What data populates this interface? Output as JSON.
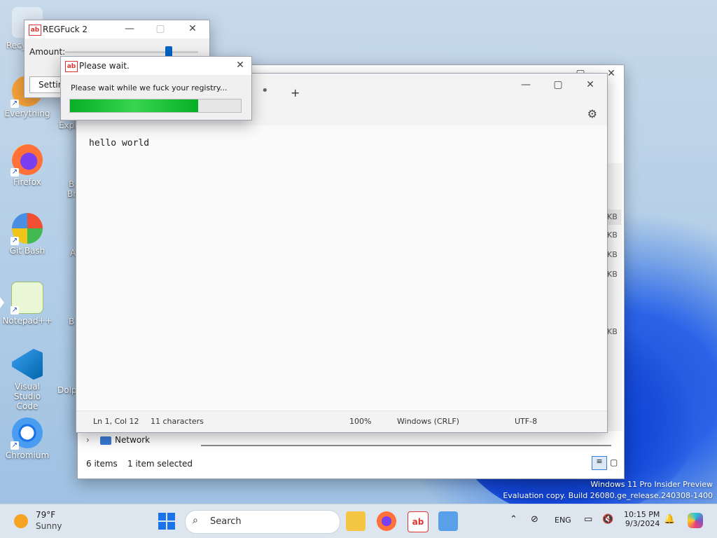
{
  "desktop": {
    "icons": [
      {
        "label": "Recy",
        "icon": "recycle-bin-icon"
      },
      {
        "label": "Everything",
        "icon": "everything-icon"
      },
      {
        "label": "Firefox",
        "icon": "firefox-icon"
      },
      {
        "label": "Git Bash",
        "icon": "git-bash-icon"
      },
      {
        "label": "Notepad++",
        "icon": "notepadpp-icon"
      },
      {
        "label": "Visual Studio Code",
        "icon": "vscode-icon"
      },
      {
        "label": "Chromium",
        "icon": "chromium-icon"
      }
    ],
    "partial_labels": [
      "Expl",
      "B",
      "Br",
      "A",
      "B",
      "Dolp"
    ]
  },
  "regfuck": {
    "title": "REGFuck 2",
    "amount_label": "Amount:",
    "settings_button": "Settin"
  },
  "wait_dialog": {
    "title": "Please wait.",
    "message": "Please wait while we fuck your registry...",
    "progress_percent": 75
  },
  "notepad": {
    "content": "hello world",
    "status": {
      "position": "Ln 1, Col 12",
      "characters": "11 characters",
      "zoom": "100%",
      "line_ending": "Windows (CRLF)",
      "encoding": "UTF-8"
    }
  },
  "explorer": {
    "nav_network": "Network",
    "status_items": "6 items",
    "status_selected": "1 item selected",
    "size_suffixes": [
      "KB",
      "KB",
      "KB",
      "KB",
      "KB"
    ]
  },
  "watermark": {
    "line1": "Windows 11 Pro Insider Preview",
    "line2": "Evaluation copy. Build 26080.ge_release.240308-1400"
  },
  "taskbar": {
    "weather_temp": "79°F",
    "weather_desc": "Sunny",
    "search_placeholder": "Search",
    "lang": "ENG",
    "time": "10:15 PM",
    "date": "9/3/2024"
  }
}
